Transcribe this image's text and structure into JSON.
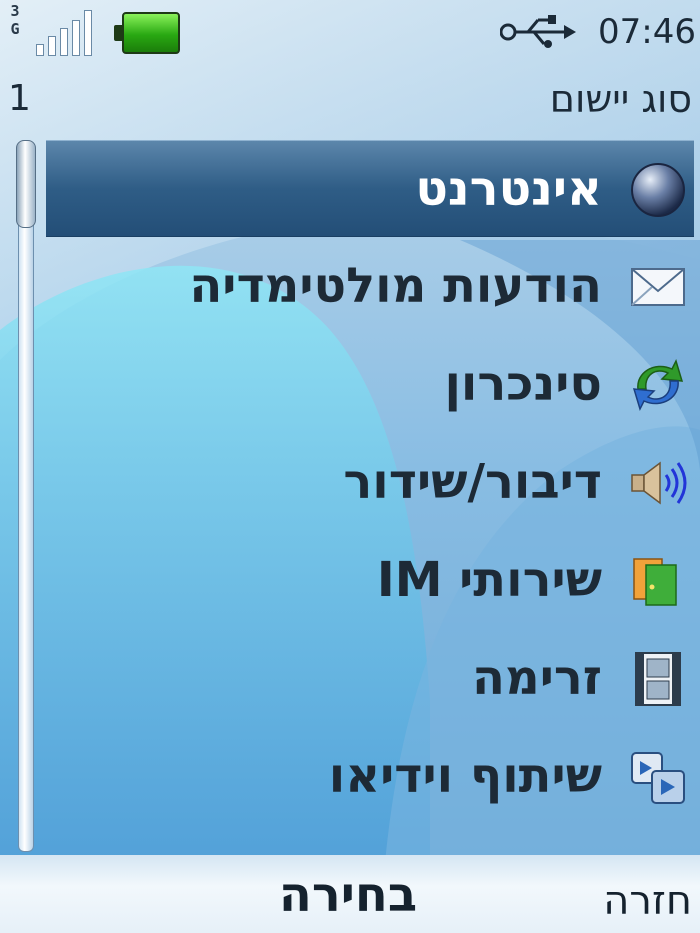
{
  "status": {
    "network": "3G",
    "signal_bars": 5,
    "battery_level": 1.0,
    "connection_icon": "usb-icon",
    "time": "07:46"
  },
  "header": {
    "page_number": "1",
    "title": "סוג יישום"
  },
  "menu": {
    "items": [
      {
        "label": "אינטרנט",
        "icon": "globe-icon"
      },
      {
        "label": "הודעות מולטימדיה",
        "icon": "envelope-icon"
      },
      {
        "label": "סינכרון",
        "icon": "sync-icon"
      },
      {
        "label": "דיבור/שידור",
        "icon": "speaker-icon"
      },
      {
        "label": "שירותי IM",
        "icon": "im-icon"
      },
      {
        "label": "זרימה",
        "icon": "film-icon"
      },
      {
        "label": "שיתוף וידיאו",
        "icon": "video-share-icon"
      }
    ],
    "selected_index": 0
  },
  "softkeys": {
    "center": "בחירה",
    "right": "חזרה"
  },
  "colors": {
    "selection": "#2f5d86",
    "text": "#1d2a36",
    "battery": "#29a812"
  }
}
